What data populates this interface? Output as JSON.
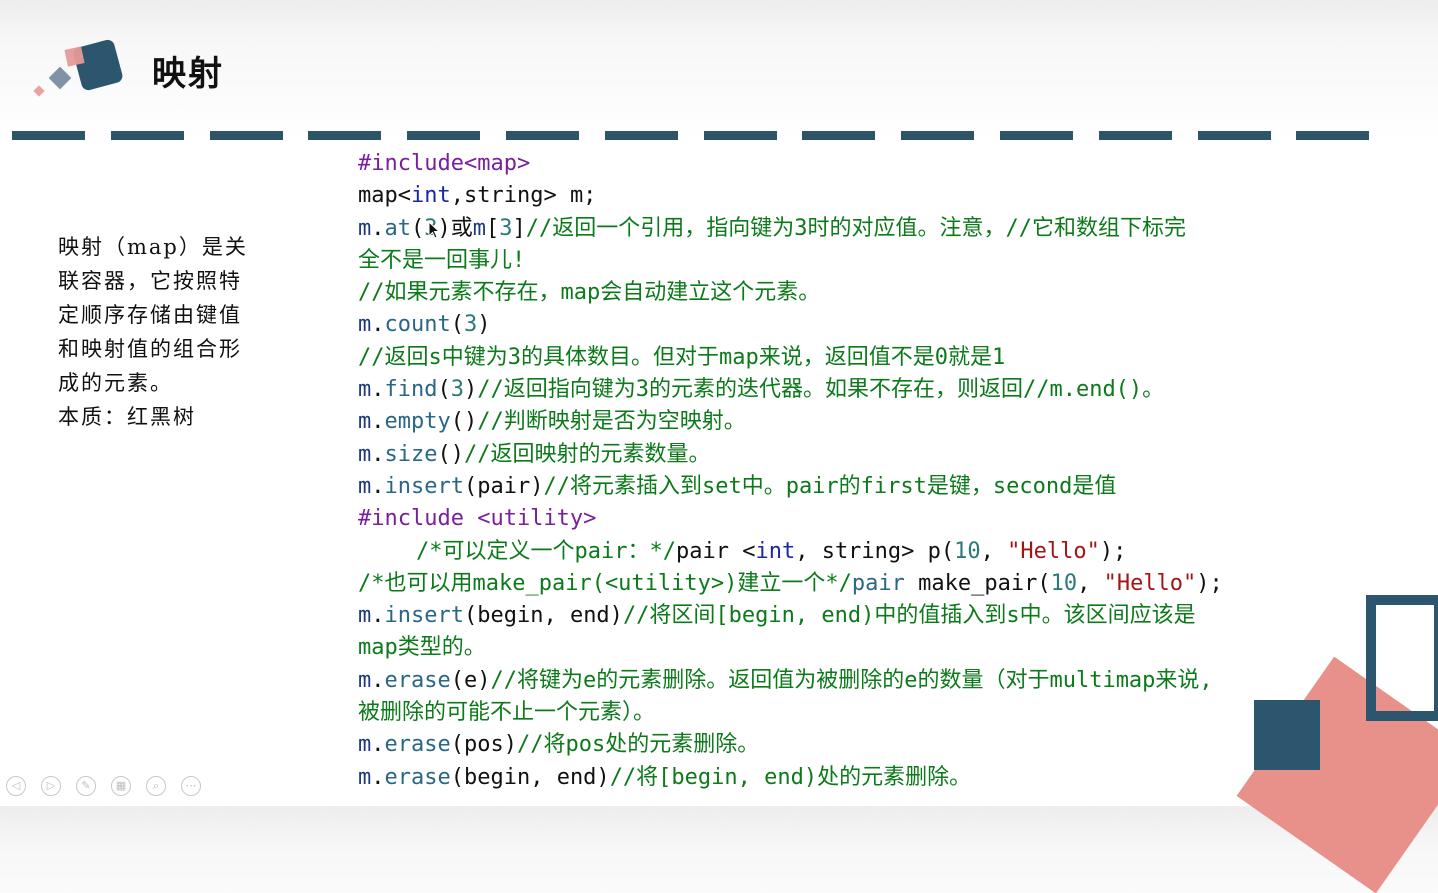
{
  "slide": {
    "title": "映射",
    "description_lines": [
      "映射（map）是关",
      "联容器，它按照特",
      "定顺序存储由键值",
      "和映射值的组合形",
      "成的元素。",
      "本质：红黑树"
    ]
  },
  "code_lines": [
    [
      {
        "t": "#include<map>",
        "c": "kw"
      }
    ],
    [
      {
        "t": "map<",
        "c": ""
      },
      {
        "t": "int",
        "c": "tp"
      },
      {
        "t": ",string> m;",
        "c": ""
      }
    ],
    [
      {
        "t": "m",
        "c": "ob"
      },
      {
        "t": ".",
        "c": ""
      },
      {
        "t": "at",
        "c": "fn"
      },
      {
        "t": "(",
        "c": ""
      },
      {
        "t": "3",
        "c": "num"
      },
      {
        "t": ")或",
        "c": ""
      },
      {
        "t": "m",
        "c": "ob"
      },
      {
        "t": "[",
        "c": ""
      },
      {
        "t": "3",
        "c": "num"
      },
      {
        "t": "]",
        "c": ""
      },
      {
        "t": "//返回一个引用，指向键为3时的对应值。注意，//它和数组下标完",
        "c": "cm"
      }
    ],
    [
      {
        "t": "全不是一回事儿!",
        "c": "cm"
      }
    ],
    [
      {
        "t": "//如果元素不存在，map会自动建立这个元素。",
        "c": "cm"
      }
    ],
    [
      {
        "t": "m",
        "c": "ob"
      },
      {
        "t": ".",
        "c": ""
      },
      {
        "t": "count",
        "c": "fn"
      },
      {
        "t": "(",
        "c": ""
      },
      {
        "t": "3",
        "c": "num"
      },
      {
        "t": ")",
        "c": ""
      }
    ],
    [
      {
        "t": "//返回s中键为3的具体数目。但对于map来说，返回值不是0就是1",
        "c": "cm"
      }
    ],
    [
      {
        "t": "m",
        "c": "ob"
      },
      {
        "t": ".",
        "c": ""
      },
      {
        "t": "find",
        "c": "fn"
      },
      {
        "t": "(",
        "c": ""
      },
      {
        "t": "3",
        "c": "num"
      },
      {
        "t": ")",
        "c": ""
      },
      {
        "t": "//返回指向键为3的元素的迭代器。如果不存在，则返回//m.end()。",
        "c": "cm"
      }
    ],
    [
      {
        "t": "m",
        "c": "ob"
      },
      {
        "t": ".",
        "c": ""
      },
      {
        "t": "empty",
        "c": "fn"
      },
      {
        "t": "()",
        "c": ""
      },
      {
        "t": "//判断映射是否为空映射。",
        "c": "cm"
      }
    ],
    [
      {
        "t": "m",
        "c": "ob"
      },
      {
        "t": ".",
        "c": ""
      },
      {
        "t": "size",
        "c": "fn"
      },
      {
        "t": "()",
        "c": ""
      },
      {
        "t": "//返回映射的元素数量。",
        "c": "cm"
      }
    ],
    [
      {
        "t": "m",
        "c": "ob"
      },
      {
        "t": ".",
        "c": ""
      },
      {
        "t": "insert",
        "c": "fn"
      },
      {
        "t": "(pair)",
        "c": ""
      },
      {
        "t": "//将元素插入到set中。pair的first是键，second是值",
        "c": "cm"
      }
    ],
    [
      {
        "t": "#include <utility>",
        "c": "kw"
      }
    ],
    [
      {
        "t": "/*可以定义一个pair：*/",
        "c": "cm"
      },
      {
        "t": "pair <",
        "c": ""
      },
      {
        "t": "int",
        "c": "tp"
      },
      {
        "t": ", string> p(",
        "c": ""
      },
      {
        "t": "10",
        "c": "num"
      },
      {
        "t": ", ",
        "c": ""
      },
      {
        "t": "\"Hello\"",
        "c": "str"
      },
      {
        "t": ");",
        "c": ""
      }
    ],
    [
      {
        "t": "/*也可以用make_pair(<utility>)建立一个*/",
        "c": "cm"
      },
      {
        "t": "pair",
        "c": "fn"
      },
      {
        "t": " make_pair(",
        "c": ""
      },
      {
        "t": "10",
        "c": "num"
      },
      {
        "t": ", ",
        "c": ""
      },
      {
        "t": "\"Hello\"",
        "c": "str"
      },
      {
        "t": ");",
        "c": ""
      }
    ],
    [
      {
        "t": "m",
        "c": "ob"
      },
      {
        "t": ".",
        "c": ""
      },
      {
        "t": "insert",
        "c": "fn"
      },
      {
        "t": "(begin, end)",
        "c": ""
      },
      {
        "t": "//将区间[begin, end)中的值插入到s中。该区间应该是",
        "c": "cm"
      }
    ],
    [
      {
        "t": "map类型的。",
        "c": "cm"
      }
    ],
    [
      {
        "t": "m",
        "c": "ob"
      },
      {
        "t": ".",
        "c": ""
      },
      {
        "t": "erase",
        "c": "fn"
      },
      {
        "t": "(e)",
        "c": ""
      },
      {
        "t": "//将键为e的元素删除。返回值为被删除的e的数量（对于multimap来说,",
        "c": "cm"
      }
    ],
    [
      {
        "t": "被删除的可能不止一个元素）。",
        "c": "cm"
      }
    ],
    [
      {
        "t": "m",
        "c": "ob"
      },
      {
        "t": ".",
        "c": ""
      },
      {
        "t": "erase",
        "c": "fn"
      },
      {
        "t": "(pos)",
        "c": ""
      },
      {
        "t": "//将pos处的元素删除。",
        "c": "cm"
      }
    ],
    [
      {
        "t": "m",
        "c": "ob"
      },
      {
        "t": ".",
        "c": ""
      },
      {
        "t": "erase",
        "c": "fn"
      },
      {
        "t": "(begin, end)",
        "c": ""
      },
      {
        "t": "//将[begin, end)处的元素删除。",
        "c": "cm"
      }
    ]
  ],
  "controls": [
    {
      "name": "prev-slide-icon",
      "glyph": "◁"
    },
    {
      "name": "next-slide-icon",
      "glyph": "▷"
    },
    {
      "name": "pen-icon",
      "glyph": "✎"
    },
    {
      "name": "slides-grid-icon",
      "glyph": "▦"
    },
    {
      "name": "zoom-icon",
      "glyph": "⌕"
    },
    {
      "name": "more-options-icon",
      "glyph": "⋯"
    }
  ],
  "colors": {
    "accent_navy": "#2c566e",
    "accent_pink": "#e8908a",
    "comment_green": "#0c7a1a",
    "keyword_purple": "#7a1f9e"
  }
}
